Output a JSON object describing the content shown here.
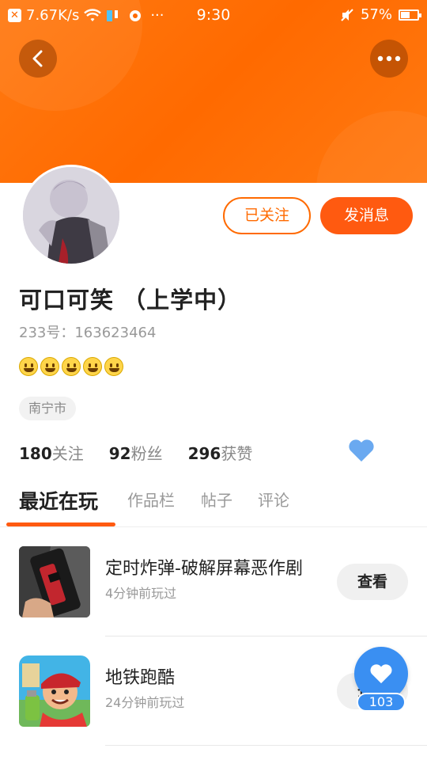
{
  "status_bar": {
    "network_speed": "7.67K/s",
    "time": "9:30",
    "battery": "57%",
    "battery_level": 0.57
  },
  "profile": {
    "nickname": "可口可笑  （上学中）",
    "uid": "233号：163623464",
    "location": "南宁市",
    "emoji_count": 5
  },
  "actions": {
    "followed_label": "已关注",
    "message_label": "发消息"
  },
  "stats": {
    "following_num": "180",
    "following_label": "关注",
    "fans_num": "92",
    "fans_label": "粉丝",
    "likes_num": "296",
    "likes_label": "获赞"
  },
  "tabs": [
    {
      "label": "最近在玩"
    },
    {
      "label": "作品栏"
    },
    {
      "label": "帖子"
    },
    {
      "label": "评论"
    }
  ],
  "games": [
    {
      "title": "定时炸弹-破解屏幕恶作剧",
      "time": "4分钟前玩过",
      "button": "查看"
    },
    {
      "title": "地铁跑酷",
      "time": "24分钟前玩过",
      "button": "查看"
    }
  ],
  "fab": {
    "count": "103"
  },
  "colors": {
    "accent": "#ff5a10",
    "header": "#ff6a00",
    "blue": "#3a8ff2",
    "heart": "#6aa9f0"
  }
}
